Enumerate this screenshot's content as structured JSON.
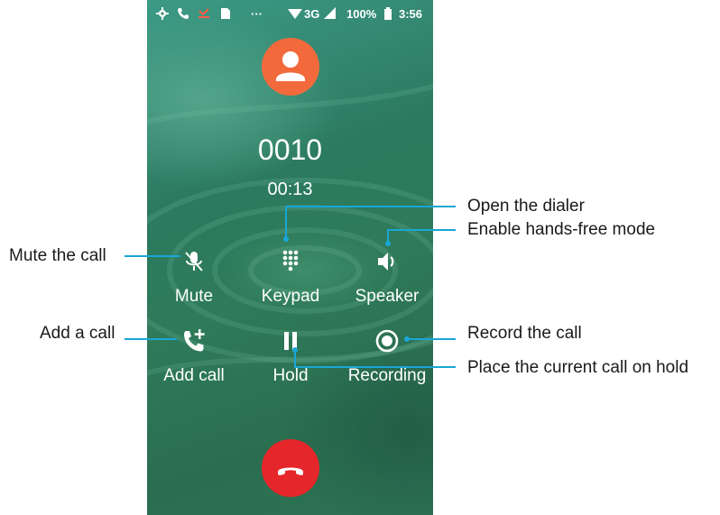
{
  "status_bar": {
    "network": "3G",
    "battery": "100%",
    "time": "3:56"
  },
  "call": {
    "number": "0010",
    "duration": "00:13"
  },
  "buttons": {
    "mute": "Mute",
    "keypad": "Keypad",
    "speaker": "Speaker",
    "add_call": "Add call",
    "hold": "Hold",
    "recording": "Recording"
  },
  "annotations": {
    "mute": "Mute the call",
    "keypad": "Open the dialer",
    "speaker": "Enable hands-free mode",
    "add_call": "Add a call",
    "recording": "Record the call",
    "hold": "Place the current call on hold"
  },
  "colors": {
    "avatar": "#f26a3c",
    "end_call": "#e5262a",
    "annotation_line": "#1aa6d6"
  }
}
